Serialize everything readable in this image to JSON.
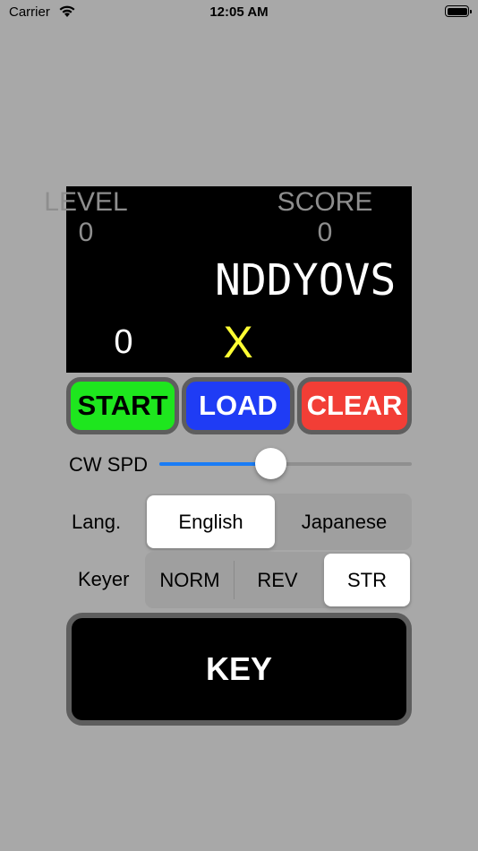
{
  "status_bar": {
    "carrier": "Carrier",
    "time": "12:05 AM"
  },
  "display": {
    "level_label": "LEVEL",
    "level_value": "0",
    "score_label": "SCORE",
    "score_value": "0",
    "cw_text": "NDDYOVS",
    "count": "0",
    "mark": "X"
  },
  "buttons": {
    "start": "START",
    "load": "LOAD",
    "clear": "CLEAR"
  },
  "speed": {
    "label": "CW SPD",
    "value_fraction": 0.44
  },
  "language": {
    "label": "Lang.",
    "options": [
      "English",
      "Japanese"
    ],
    "selected": "English"
  },
  "keyer": {
    "label": "Keyer",
    "options": [
      "NORM",
      "REV",
      "STR"
    ],
    "selected": "STR"
  },
  "key_button": {
    "label": "KEY"
  },
  "colors": {
    "start": "#1ee61e",
    "load": "#1f3cf5",
    "clear": "#f23e36",
    "accent": "#1a7cf5",
    "mark": "#ffff33"
  }
}
